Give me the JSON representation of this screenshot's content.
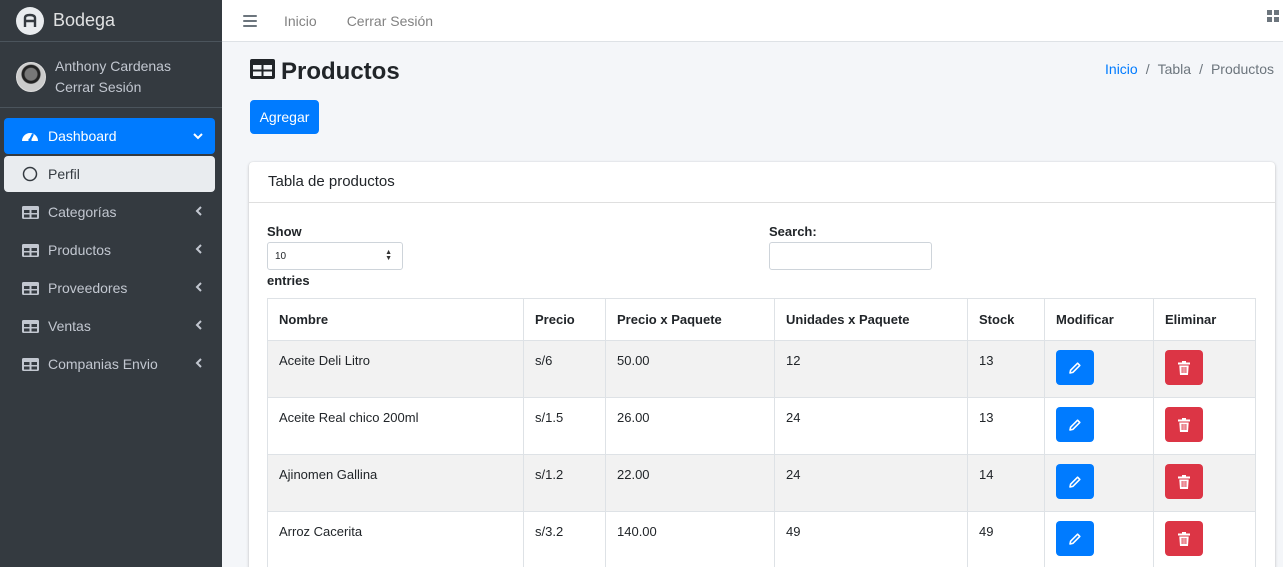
{
  "brand": {
    "name": "Bodega"
  },
  "user": {
    "name": "Anthony Cardenas",
    "logout": "Cerrar Sesión"
  },
  "sidebar": {
    "items": [
      {
        "label": "Dashboard",
        "icon": "dashboard-icon"
      },
      {
        "label": "Perfil",
        "icon": "circle-icon"
      },
      {
        "label": "Categorías",
        "icon": "table-icon"
      },
      {
        "label": "Productos",
        "icon": "table-icon"
      },
      {
        "label": "Proveedores",
        "icon": "table-icon"
      },
      {
        "label": "Ventas",
        "icon": "table-icon"
      },
      {
        "label": "Companias Envio",
        "icon": "table-icon"
      }
    ]
  },
  "topbar": {
    "inicio": "Inicio",
    "cerrar": "Cerrar Sesión"
  },
  "page": {
    "title": "Productos",
    "breadcrumb": [
      "Inicio",
      "/",
      "Tabla",
      "/",
      "Productos"
    ],
    "add_button": "Agregar"
  },
  "card": {
    "title": "Tabla de productos",
    "show_label": "Show",
    "length_value": "10",
    "entries_label": "entries",
    "search_label": "Search:"
  },
  "table": {
    "headers": [
      "Nombre",
      "Precio",
      "Precio x Paquete",
      "Unidades x Paquete",
      "Stock",
      "Modificar",
      "Eliminar"
    ],
    "rows": [
      [
        "Aceite Deli Litro",
        "s/6",
        "50.00",
        "12",
        "13"
      ],
      [
        "Aceite Real chico 200ml",
        "s/1.5",
        "26.00",
        "24",
        "13"
      ],
      [
        "Ajinomen Gallina",
        "s/1.2",
        "22.00",
        "24",
        "14"
      ],
      [
        "Arroz Cacerita",
        "s/3.2",
        "140.00",
        "49",
        "49"
      ]
    ]
  },
  "colors": {
    "primary": "#007bff",
    "danger": "#dc3545",
    "sidebar": "#343a40"
  }
}
